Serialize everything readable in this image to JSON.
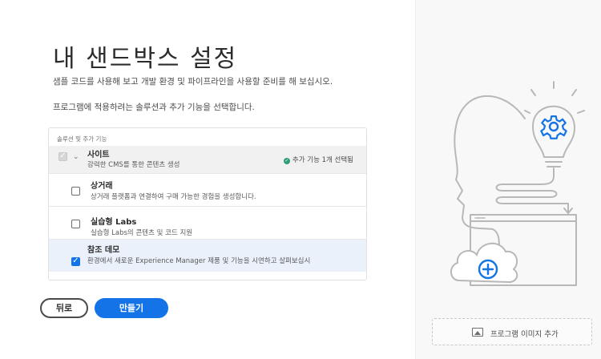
{
  "header": {
    "title": "내 샌드박스 설정",
    "subtitle": "샘플 코드를 사용해 보고 개발 환경 및 파이프라인을 사용할 준비를 해 보십시오.",
    "instruction": "프로그램에 적용하려는 솔루션과 추가 기능을 선택합니다."
  },
  "panel": {
    "header": "솔루션 및 추가 기능",
    "parent": {
      "title": "사이트",
      "description": "강력한 CMS를 통한 콘텐츠 생성",
      "badge": "추가 기능 1개 선택됨",
      "checked": true,
      "disabled": true
    },
    "items": [
      {
        "title": "상거래",
        "description": "상거래 플랫폼과 연결하여 구매 가능한 경험을 생성합니다.",
        "checked": false
      },
      {
        "title": "실습형 Labs",
        "description": "실습형 Labs의 콘텐츠 및 코드 지원",
        "checked": false
      },
      {
        "title": "참조 데모",
        "description": "환경에서 새로운 Experience Manager 제품 및 기능을 시연하고 살펴보십시",
        "checked": true
      }
    ]
  },
  "buttons": {
    "back": "뒤로",
    "create": "만들기"
  },
  "side": {
    "add_image_label": "프로그램 이미지 추가",
    "icon_names": [
      "lightbulb-gear-illustration",
      "cloud-plus-icon",
      "image-icon"
    ]
  },
  "colors": {
    "accent": "#1473e6",
    "success": "#2d9d78",
    "illustration_stroke": "#b8b8b8"
  }
}
